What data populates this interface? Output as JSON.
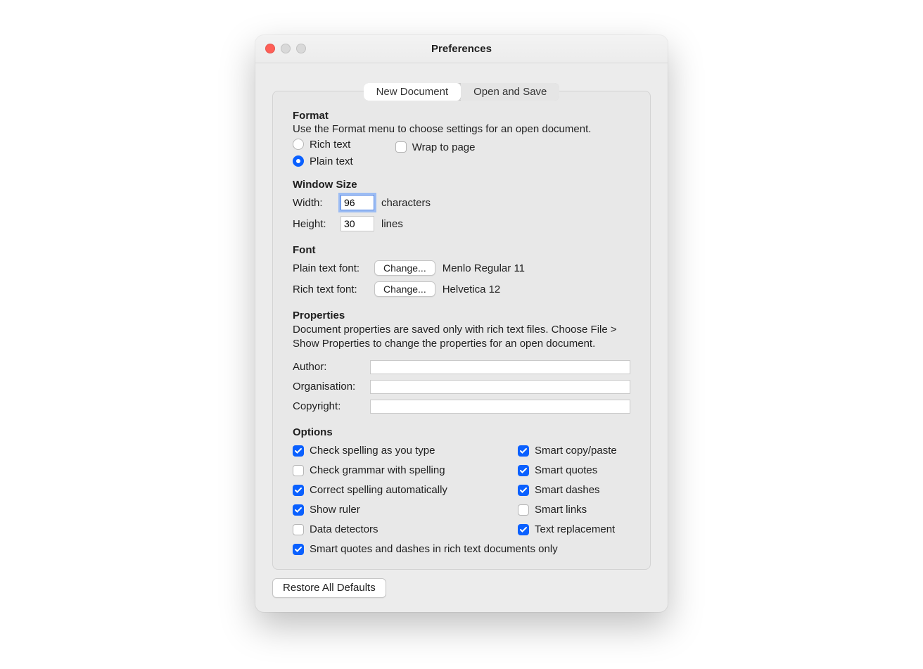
{
  "window": {
    "title": "Preferences"
  },
  "tabs": {
    "new_document": "New Document",
    "open_and_save": "Open and Save",
    "active": "new_document"
  },
  "format": {
    "heading": "Format",
    "desc": "Use the Format menu to choose settings for an open document.",
    "rich_text": "Rich text",
    "plain_text": "Plain text",
    "wrap_to_page": "Wrap to page",
    "selected": "plain_text",
    "wrap_checked": false
  },
  "window_size": {
    "heading": "Window Size",
    "width_label": "Width:",
    "width_value": "96",
    "width_unit": "characters",
    "height_label": "Height:",
    "height_value": "30",
    "height_unit": "lines"
  },
  "font": {
    "heading": "Font",
    "plain_label": "Plain text font:",
    "rich_label": "Rich text font:",
    "change": "Change...",
    "plain_value": "Menlo Regular 11",
    "rich_value": "Helvetica 12"
  },
  "properties": {
    "heading": "Properties",
    "desc": "Document properties are saved only with rich text files. Choose File > Show Properties to change the properties for an open document.",
    "author_label": "Author:",
    "org_label": "Organisation:",
    "copyright_label": "Copyright:",
    "author_value": "",
    "org_value": "",
    "copyright_value": ""
  },
  "options": {
    "heading": "Options",
    "check_spelling": {
      "label": "Check spelling as you type",
      "checked": true
    },
    "check_grammar": {
      "label": "Check grammar with spelling",
      "checked": false
    },
    "correct_spelling": {
      "label": "Correct spelling automatically",
      "checked": true
    },
    "show_ruler": {
      "label": "Show ruler",
      "checked": true
    },
    "data_detectors": {
      "label": "Data detectors",
      "checked": false
    },
    "smart_copy_paste": {
      "label": "Smart copy/paste",
      "checked": true
    },
    "smart_quotes": {
      "label": "Smart quotes",
      "checked": true
    },
    "smart_dashes": {
      "label": "Smart dashes",
      "checked": true
    },
    "smart_links": {
      "label": "Smart links",
      "checked": false
    },
    "text_replacement": {
      "label": "Text replacement",
      "checked": true
    },
    "rich_only": {
      "label": "Smart quotes and dashes in rich text documents only",
      "checked": true
    }
  },
  "footer": {
    "restore": "Restore All Defaults"
  }
}
